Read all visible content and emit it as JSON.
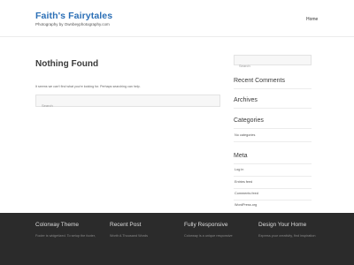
{
  "site": {
    "title": "Faith's Fairytales",
    "tagline": "Photography by Ownbeyphotography.com",
    "nav_home": "Home"
  },
  "main": {
    "page_title": "Nothing Found",
    "message": "It seems we can't find what you're looking for. Perhaps searching can help.",
    "search_placeholder": "Search"
  },
  "sidebar": {
    "search_placeholder": "Search",
    "recent_comments_heading": "Recent Comments",
    "archives_heading": "Archives",
    "categories_heading": "Categories",
    "categories_empty": "No categories",
    "meta_heading": "Meta",
    "meta_links": [
      "Log in",
      "Entries feed",
      "Comments feed",
      "WordPress.org"
    ]
  },
  "footer": {
    "columns": [
      {
        "title": "Colorway Theme",
        "snippet": "Fooler is widgetized. To setup the footer,"
      },
      {
        "title": "Recent Post",
        "snippet": "Worth A Thousand Words"
      },
      {
        "title": "Fully Responsive",
        "snippet": "Colorway is a unique responsive"
      },
      {
        "title": "Design Your Home",
        "snippet": "Express your creativity, find inspiration"
      }
    ]
  },
  "colors": {
    "accent": "#2b6fb6",
    "footer_bg": "#2b2b2b"
  }
}
